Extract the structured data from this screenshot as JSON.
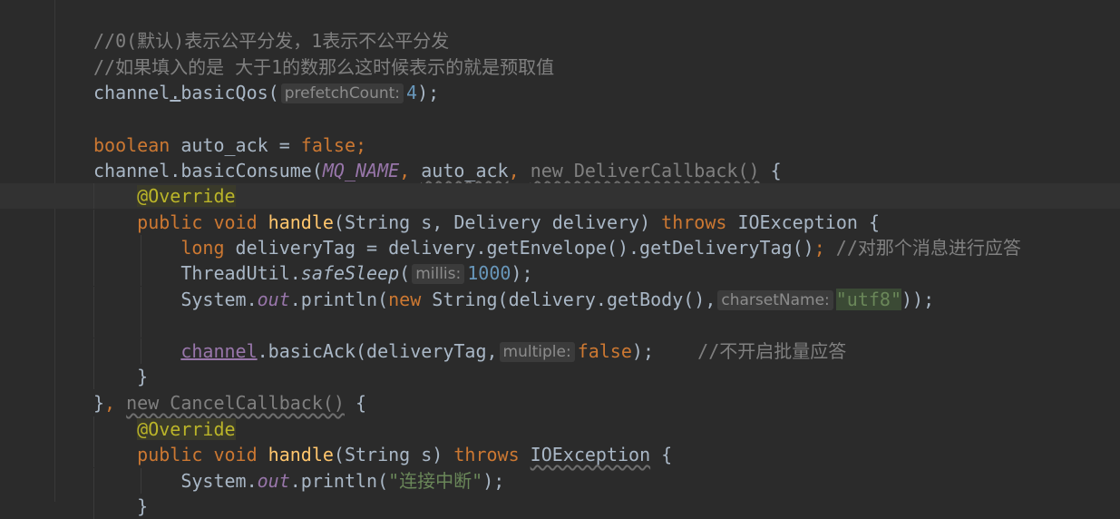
{
  "editor": {
    "lines": {
      "l1": {
        "comment": "//0(默认)表示公平分发，1表示不公平分发"
      },
      "l2": {
        "comment": "//如果填入的是 大于1的数那么这时候表示的就是预取值"
      },
      "l3": {
        "obj": "channel",
        "dot": ".",
        "method": "basicQos(",
        "hint": "prefetchCount:",
        "num": "4",
        "end": ");"
      },
      "l5": {
        "kw1": "boolean",
        "text1": " auto_ack = ",
        "kw2": "false",
        "end": ";"
      },
      "l6": {
        "obj": "channel.basicConsume(",
        "const": "MQ_NAME",
        "comma1": ", ",
        "arg": "auto_ack",
        "comma2": ", ",
        "anon": "new DeliverCallback()",
        "end": " {"
      },
      "l7": {
        "annotation": "@Override"
      },
      "l8": {
        "kw1": "public void ",
        "method": "handle",
        "params": "(String s, Delivery delivery) ",
        "kw2": "throws",
        "rest": " IOException {"
      },
      "l9": {
        "kw": "long",
        "text": " deliveryTag = delivery.getEnvelope().getDeliveryTag()",
        "semi": ";",
        "comment": " //对那个消息进行应答"
      },
      "l10": {
        "cls": "ThreadUtil.",
        "static": "safeSleep",
        "paren": "(",
        "hint": "millis:",
        "num": "1000",
        "end": ");"
      },
      "l11": {
        "cls": "System.",
        "field": "out",
        "call": ".println(",
        "kw": "new",
        "text": " String(delivery.getBody(),",
        "hint": "charsetName:",
        "str": "\"utf8\"",
        "end": "));"
      },
      "l13": {
        "field": "channel",
        "call": ".basicAck(deliveryTag,",
        "hint": "multiple:",
        "kw": "false",
        "end": ");",
        "comment": "    //不开启批量应答"
      },
      "l14": {
        "text": "}"
      },
      "l15": {
        "brace": "}",
        "comma": ", ",
        "anon": "new CancelCallback()",
        "end": " {"
      },
      "l16": {
        "annotation": "@Override"
      },
      "l17": {
        "kw1": "public void ",
        "method": "handle",
        "params": "(String s) ",
        "kw2": "throws",
        "space": " ",
        "exc": "IOException",
        "end": " {"
      },
      "l18": {
        "cls": "System.",
        "field": "out",
        "call": ".println(",
        "str": "\"连接中断\"",
        "end": ");"
      },
      "l19": {
        "text": "}"
      }
    }
  }
}
